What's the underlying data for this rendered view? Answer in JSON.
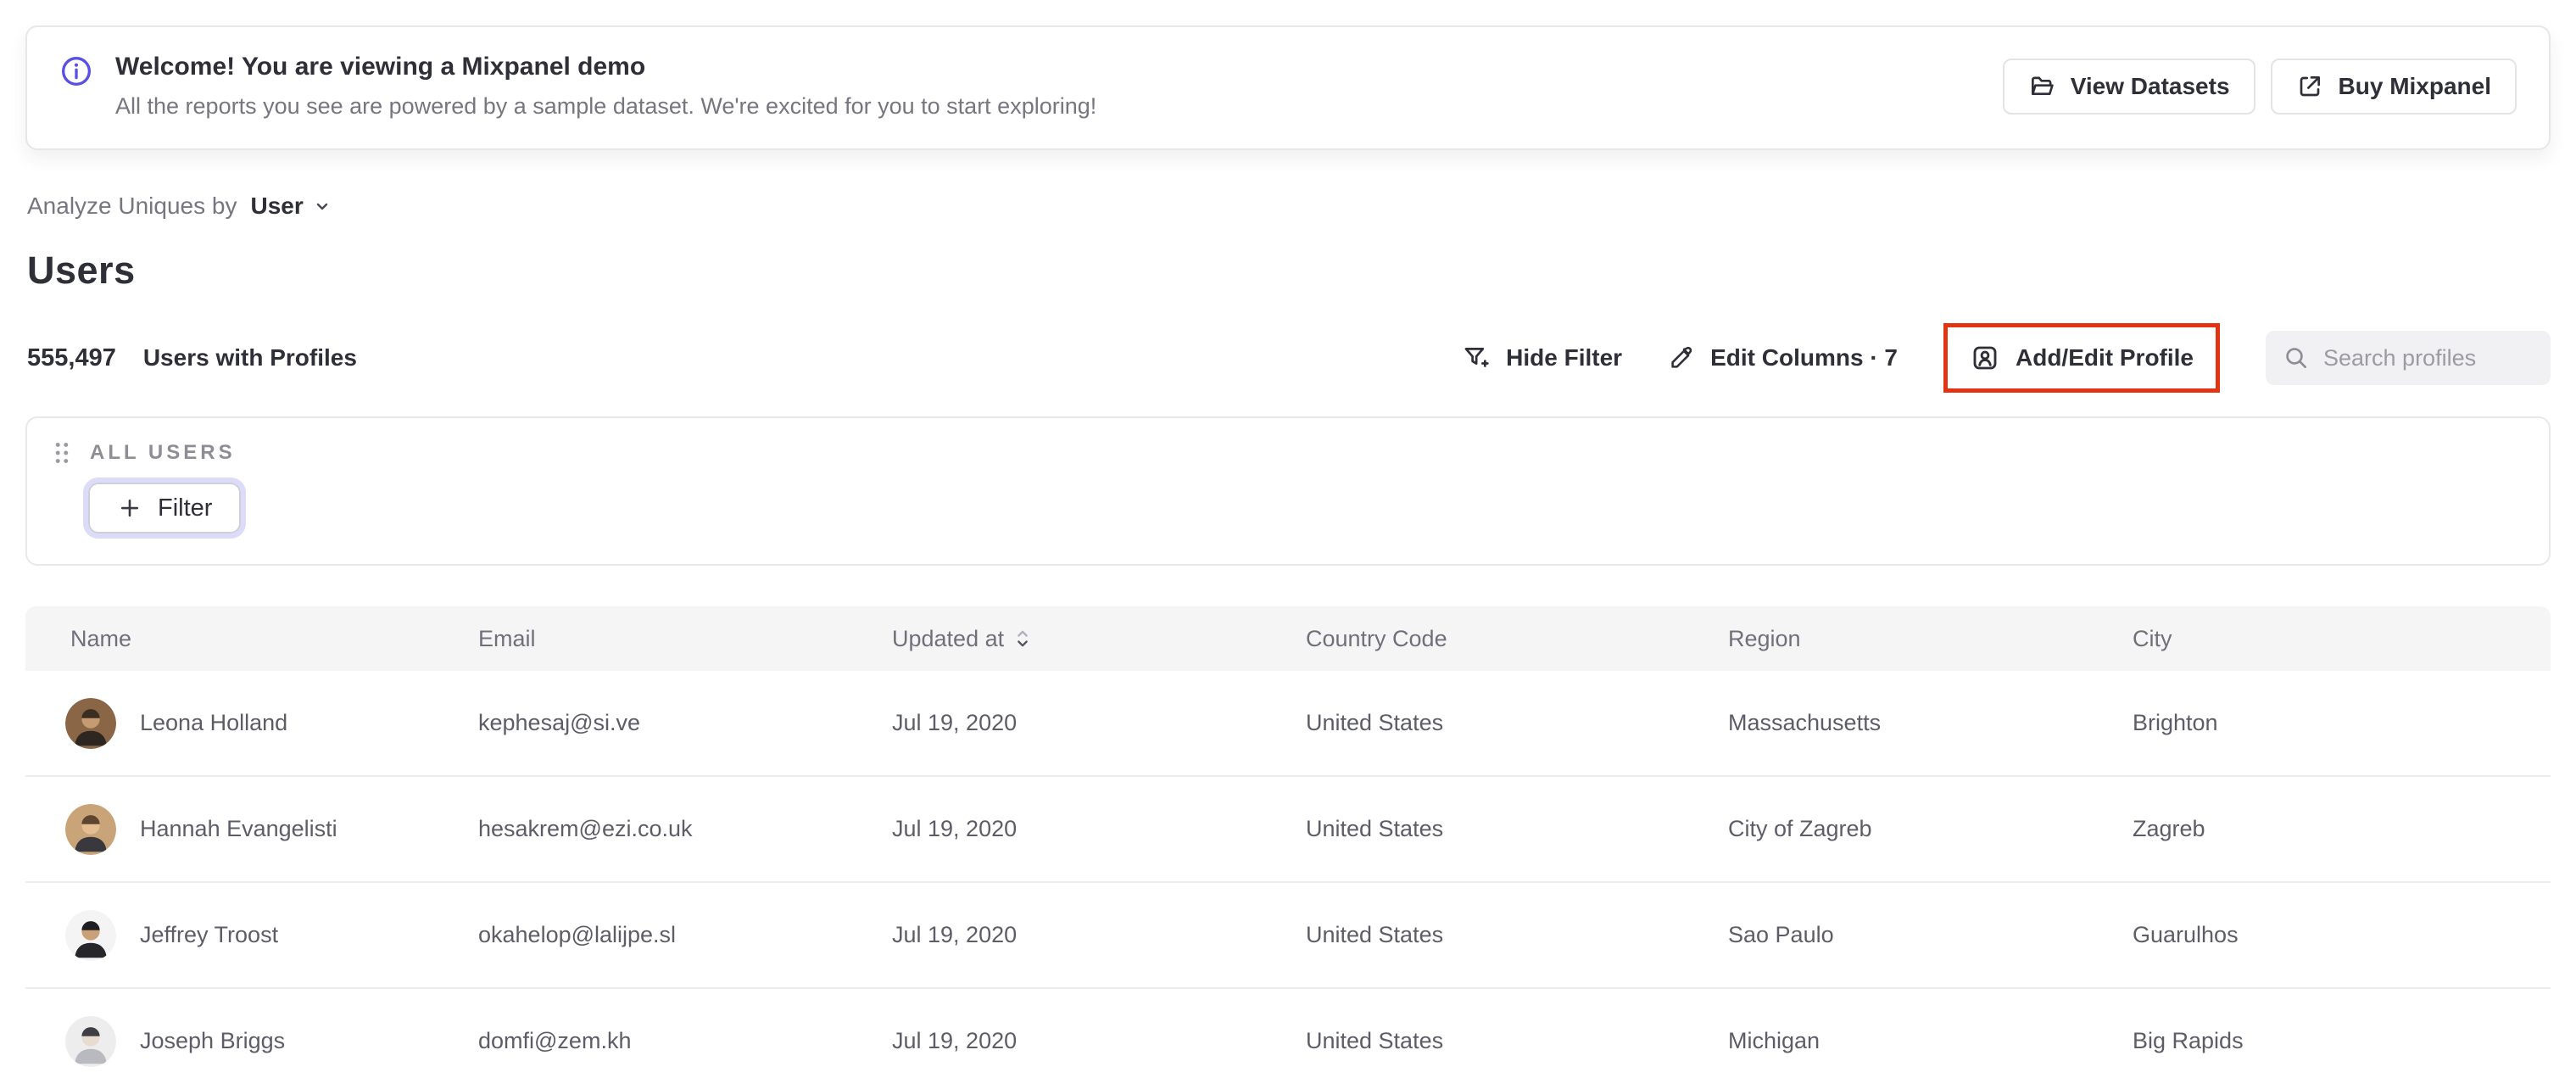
{
  "banner": {
    "title": "Welcome! You are viewing a Mixpanel demo",
    "subtitle": "All the reports you see are powered by a sample dataset. We're excited for you to start exploring!",
    "view_datasets_label": "View Datasets",
    "buy_mixpanel_label": "Buy Mixpanel"
  },
  "controls": {
    "analyze_prefix": "Analyze Uniques by",
    "analyze_value": "User",
    "page_title": "Users",
    "profile_count": "555,497",
    "profile_count_label": "Users with Profiles",
    "hide_filter_label": "Hide Filter",
    "edit_columns_label": "Edit Columns · 7",
    "add_edit_profile_label": "Add/Edit Profile",
    "search_placeholder": "Search profiles"
  },
  "filter_card": {
    "group_label": "ALL USERS",
    "filter_button_label": "Filter"
  },
  "table": {
    "columns": [
      "Name",
      "Email",
      "Updated at",
      "Country Code",
      "Region",
      "City"
    ],
    "rows": [
      {
        "name": "Leona Holland",
        "email": "kephesaj@si.ve",
        "updated_at": "Jul 19, 2020",
        "country": "United States",
        "region": "Massachusetts",
        "city": "Brighton",
        "avatar": {
          "bg": "#8a6647",
          "skin": "#c59b72",
          "hair": "#3a2d22",
          "shirt": "#2e2620"
        }
      },
      {
        "name": "Hannah Evangelisti",
        "email": "hesakrem@ezi.co.uk",
        "updated_at": "Jul 19, 2020",
        "country": "United States",
        "region": "City of Zagreb",
        "city": "Zagreb",
        "avatar": {
          "bg": "#c9a478",
          "skin": "#e5bd92",
          "hair": "#5d4530",
          "shirt": "#38383d"
        }
      },
      {
        "name": "Jeffrey Troost",
        "email": "okahelop@lalijpe.sl",
        "updated_at": "Jul 19, 2020",
        "country": "United States",
        "region": "Sao Paulo",
        "city": "Guarulhos",
        "avatar": {
          "bg": "#f4f4f5",
          "skin": "#c9a078",
          "hair": "#1d1d22",
          "shirt": "#26262b"
        }
      },
      {
        "name": "Joseph Briggs",
        "email": "domfi@zem.kh",
        "updated_at": "Jul 19, 2020",
        "country": "United States",
        "region": "Michigan",
        "city": "Big Rapids",
        "avatar": {
          "bg": "#ededee",
          "skin": "#e8dcd0",
          "hair": "#3e3e44",
          "shirt": "#b9b9c0"
        }
      }
    ]
  },
  "colors": {
    "accent_purple": "#5a50e6",
    "annotation_red": "#e23312",
    "focus_ring_lavender": "#dcdbf8"
  }
}
